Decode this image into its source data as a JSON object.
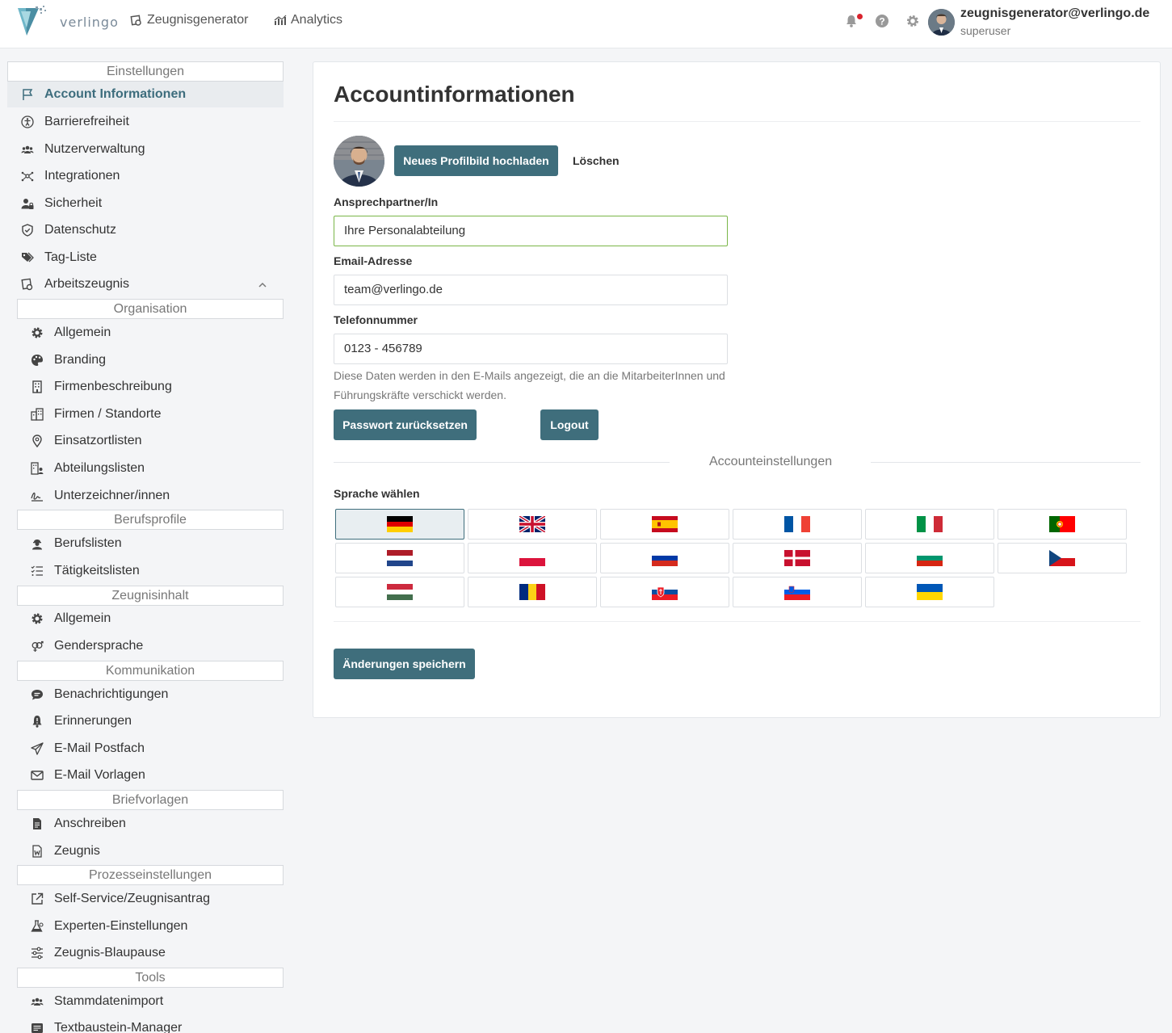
{
  "header": {
    "logo_text": "verlingo",
    "nav": [
      {
        "label": "Zeugnisgenerator",
        "icon": "certificate-icon"
      },
      {
        "label": "Analytics",
        "icon": "chart-icon"
      }
    ],
    "user_email": "zeugnisgenerator@verlingo.de",
    "user_role": "superuser"
  },
  "sidebar": {
    "sections": [
      "Einstellungen",
      "Organisation",
      "Berufsprofile",
      "Zeugnisinhalt",
      "Kommunikation",
      "Briefvorlagen",
      "Prozesseinstellungen",
      "Tools"
    ],
    "top_items": [
      {
        "label": "Account Informationen",
        "icon": "flag-icon",
        "active": true
      },
      {
        "label": "Barrierefreiheit",
        "icon": "accessibility-icon"
      },
      {
        "label": "Nutzerverwaltung",
        "icon": "users-icon"
      },
      {
        "label": "Integrationen",
        "icon": "integrations-icon"
      },
      {
        "label": "Sicherheit",
        "icon": "user-lock-icon"
      },
      {
        "label": "Datenschutz",
        "icon": "shield-icon"
      },
      {
        "label": "Tag-Liste",
        "icon": "tags-icon"
      },
      {
        "label": "Arbeitszeugnis",
        "icon": "certificate-icon"
      }
    ],
    "organisation": [
      {
        "label": "Allgemein",
        "icon": "gear-icon"
      },
      {
        "label": "Branding",
        "icon": "palette-icon"
      },
      {
        "label": "Firmenbeschreibung",
        "icon": "building-icon"
      },
      {
        "label": "Firmen / Standorte",
        "icon": "buildings-icon"
      },
      {
        "label": "Einsatzortlisten",
        "icon": "location-icon"
      },
      {
        "label": "Abteilungslisten",
        "icon": "department-icon"
      },
      {
        "label": "Unterzeichner/innen",
        "icon": "signature-icon"
      }
    ],
    "berufsprofile": [
      {
        "label": "Berufslisten",
        "icon": "worker-icon"
      },
      {
        "label": "Tätigkeitslisten",
        "icon": "checklist-icon"
      }
    ],
    "zeugnisinhalt": [
      {
        "label": "Allgemein",
        "icon": "gear-icon"
      },
      {
        "label": "Gendersprache",
        "icon": "gender-icon"
      }
    ],
    "kommunikation": [
      {
        "label": "Benachrichtigungen",
        "icon": "chat-icon"
      },
      {
        "label": "Erinnerungen",
        "icon": "bell-icon"
      },
      {
        "label": "E-Mail Postfach",
        "icon": "send-icon"
      },
      {
        "label": "E-Mail Vorlagen",
        "icon": "envelope-icon"
      }
    ],
    "briefvorlagen": [
      {
        "label": "Anschreiben",
        "icon": "document-icon"
      },
      {
        "label": "Zeugnis",
        "icon": "word-document-icon"
      }
    ],
    "prozesseinstellungen": [
      {
        "label": "Self-Service/Zeugnisantrag",
        "icon": "external-link-icon"
      },
      {
        "label": "Experten-Einstellungen",
        "icon": "flask-icon"
      },
      {
        "label": "Zeugnis-Blaupause",
        "icon": "sliders-icon"
      }
    ],
    "tools": [
      {
        "label": "Stammdatenimport",
        "icon": "users-icon"
      },
      {
        "label": "Textbaustein-Manager",
        "icon": "text-block-icon"
      }
    ]
  },
  "main": {
    "title": "Accountinformationen",
    "upload_button": "Neues Profilbild hochladen",
    "delete_button": "Löschen",
    "contact_label": "Ansprechpartner/In",
    "contact_value": "Ihre Personalabteilung",
    "email_label": "Email-Adresse",
    "email_value": "team@verlingo.de",
    "phone_label": "Telefonnummer",
    "phone_value": "0123 - 456789",
    "hint": "Diese Daten werden in den E-Mails angezeigt, die an die MitarbeiterInnen und Führungskräfte verschickt werden.",
    "reset_password_button": "Passwort zurücksetzen",
    "logout_button": "Logout",
    "account_settings_divider": "Accounteinstellungen",
    "language_label": "Sprache wählen",
    "selected_language": "de",
    "languages": [
      "de",
      "en",
      "es",
      "fr",
      "it",
      "pt",
      "nl",
      "pl",
      "ru",
      "dk",
      "bg",
      "cz",
      "hu",
      "ro",
      "sk",
      "si",
      "ua"
    ],
    "save_button": "Änderungen speichern"
  },
  "colors": {
    "primary": "#3f6e7c",
    "active_text": "#3d6d7d",
    "focus_border": "#7ab648",
    "notification_dot": "#d9232d"
  }
}
